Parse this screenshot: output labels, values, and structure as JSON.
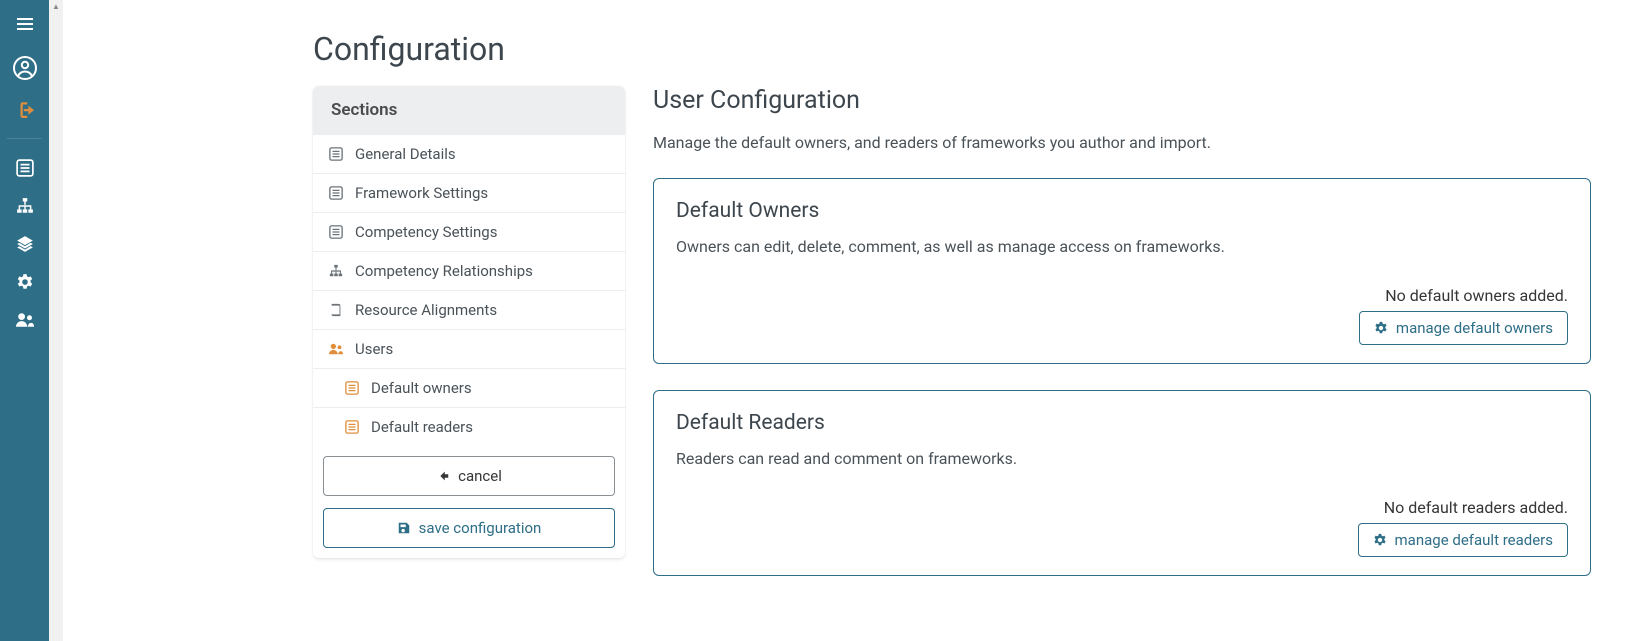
{
  "page": {
    "title": "Configuration"
  },
  "sections_panel": {
    "header": "Sections",
    "items": [
      {
        "label": "General Details",
        "icon": "list",
        "sub": false
      },
      {
        "label": "Framework Settings",
        "icon": "list",
        "sub": false
      },
      {
        "label": "Competency Settings",
        "icon": "list",
        "sub": false
      },
      {
        "label": "Competency Relationships",
        "icon": "sitemap",
        "sub": false
      },
      {
        "label": "Resource Alignments",
        "icon": "book",
        "sub": false
      },
      {
        "label": "Users",
        "icon": "users-accent",
        "sub": false
      },
      {
        "label": "Default owners",
        "icon": "list-accent",
        "sub": true
      },
      {
        "label": "Default readers",
        "icon": "list-accent",
        "sub": true
      }
    ],
    "cancel_label": "cancel",
    "save_label": "save configuration"
  },
  "content": {
    "title": "User Configuration",
    "description": "Manage the default owners, and readers of frameworks you author and import.",
    "cards": {
      "owners": {
        "title": "Default Owners",
        "description": "Owners can edit, delete, comment, as well as manage access on frameworks.",
        "empty": "No default owners added.",
        "manage_label": "manage default owners"
      },
      "readers": {
        "title": "Default Readers",
        "description": "Readers can read and comment on frameworks.",
        "empty": "No default readers added.",
        "manage_label": "manage default readers"
      }
    }
  }
}
